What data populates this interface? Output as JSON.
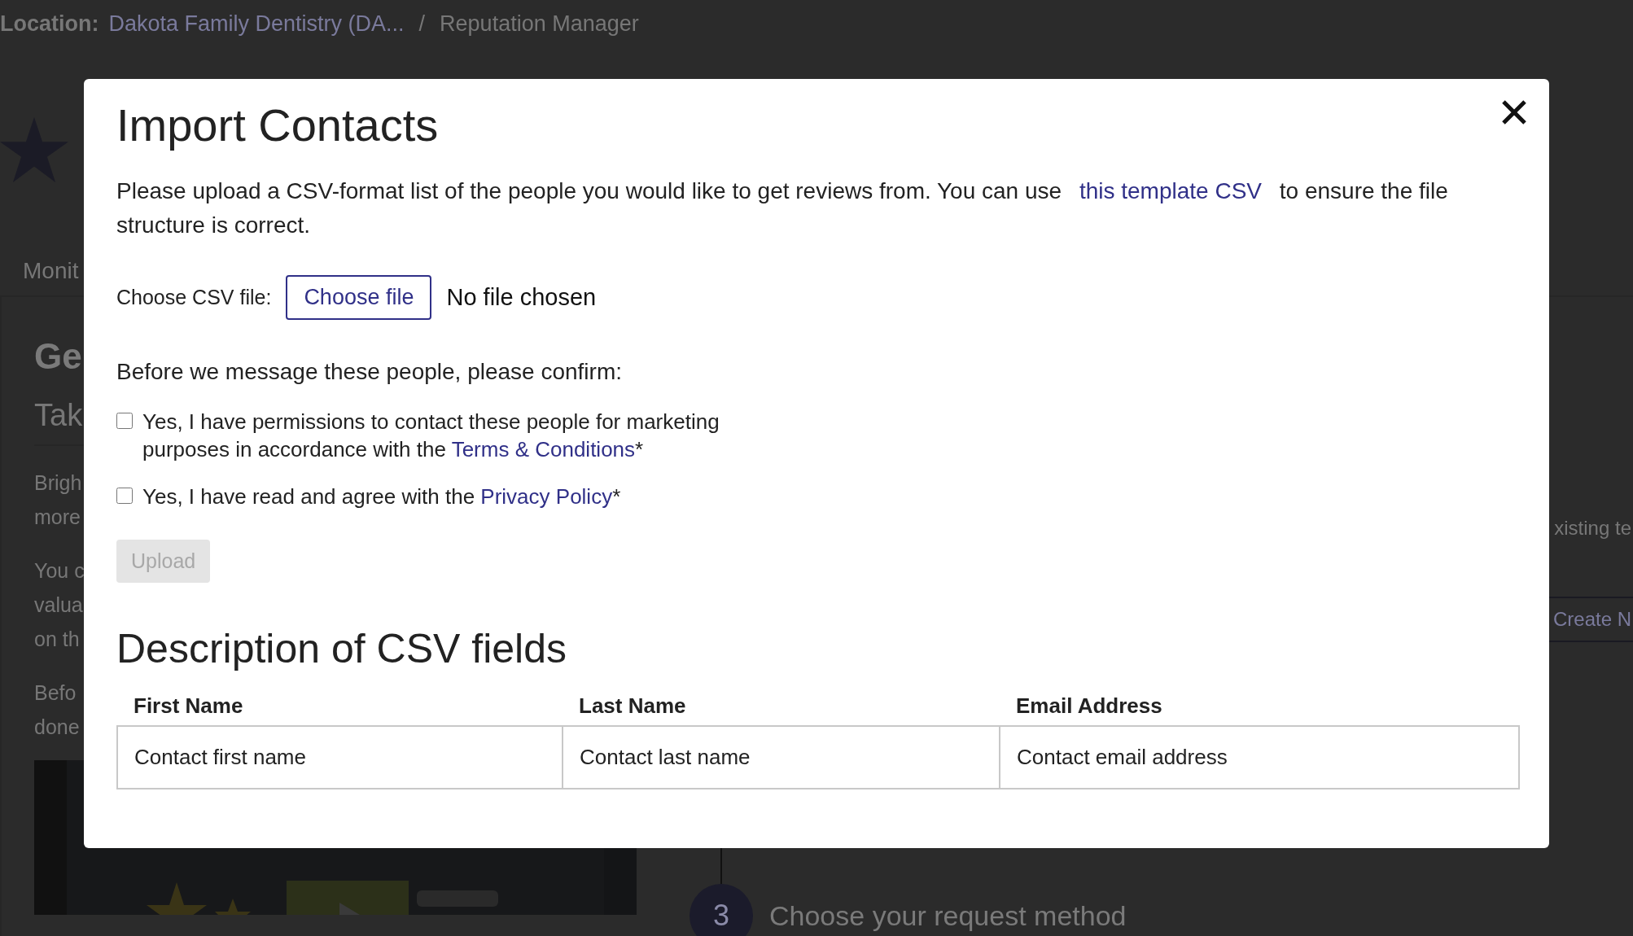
{
  "page": {
    "breadcrumb": {
      "label": "Location:",
      "location": "Dakota Family Dentistry (DA...",
      "separator": "/",
      "current": "Reputation Manager"
    },
    "tab": "Monit",
    "heading": "Ge",
    "subheading": "Tak",
    "paragraphs": [
      [
        "Brigh",
        "more"
      ],
      [
        "You c",
        "valua",
        "on th"
      ],
      [
        "Befo",
        "done"
      ]
    ],
    "video": {
      "kind": "picture"
    },
    "side_text": "xisting te",
    "side_button": "Create N",
    "step": {
      "number": "3",
      "title": "Choose your request method"
    }
  },
  "dialog": {
    "title": "Import Contacts",
    "intro": {
      "before": "Please upload a CSV-format list of the people you would like to get reviews from. You can use ",
      "link": "this template CSV",
      "after": " to ensure the file structure is correct."
    },
    "file": {
      "label": "Choose CSV file:",
      "button": "Choose file",
      "status": "No file chosen"
    },
    "confirm_prompt": "Before we message these people, please confirm:",
    "checkboxes": [
      {
        "text": "Yes, I have permissions to contact these people for marketing purposes in accordance with the ",
        "link": "Terms & Conditions",
        "suffix": "*",
        "checked": false
      },
      {
        "text": "Yes, I have read and agree with the ",
        "link": "Privacy Policy",
        "suffix": "*",
        "checked": false
      }
    ],
    "upload": {
      "label": "Upload",
      "disabled": true
    },
    "section_title": "Description of CSV fields",
    "table": {
      "columns": [
        "First Name",
        "Last Name",
        "Email Address"
      ],
      "rows": [
        [
          "Contact first name",
          "Contact last name",
          "Contact email address"
        ]
      ]
    }
  }
}
